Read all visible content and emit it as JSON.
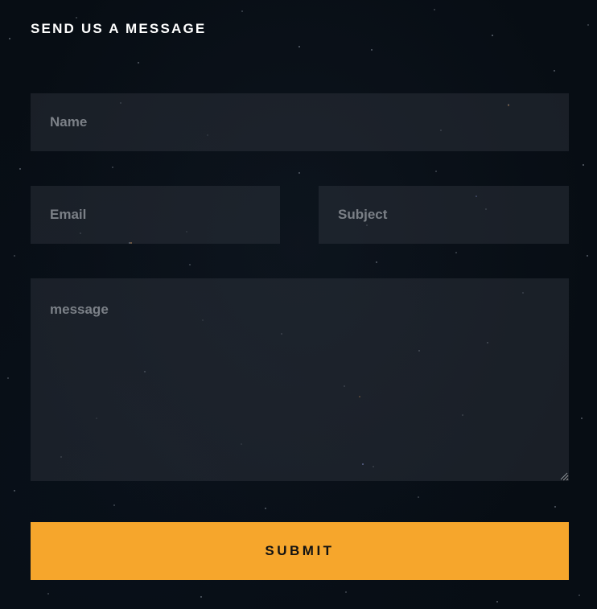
{
  "form": {
    "title": "SEND US A MESSAGE",
    "fields": {
      "name": {
        "value": "",
        "placeholder": "Name"
      },
      "email": {
        "value": "",
        "placeholder": "Email"
      },
      "subject": {
        "value": "",
        "placeholder": "Subject"
      },
      "message": {
        "value": "",
        "placeholder": "message"
      }
    },
    "submit_label": "SUBMIT"
  },
  "colors": {
    "background": "#070d14",
    "field_background": "#1f242b",
    "placeholder_text": "#7b8087",
    "title_text": "#ffffff",
    "submit_background": "#f6a62c",
    "submit_text": "#121212"
  },
  "icons": {
    "textarea_resize": "resize-grip-icon"
  }
}
